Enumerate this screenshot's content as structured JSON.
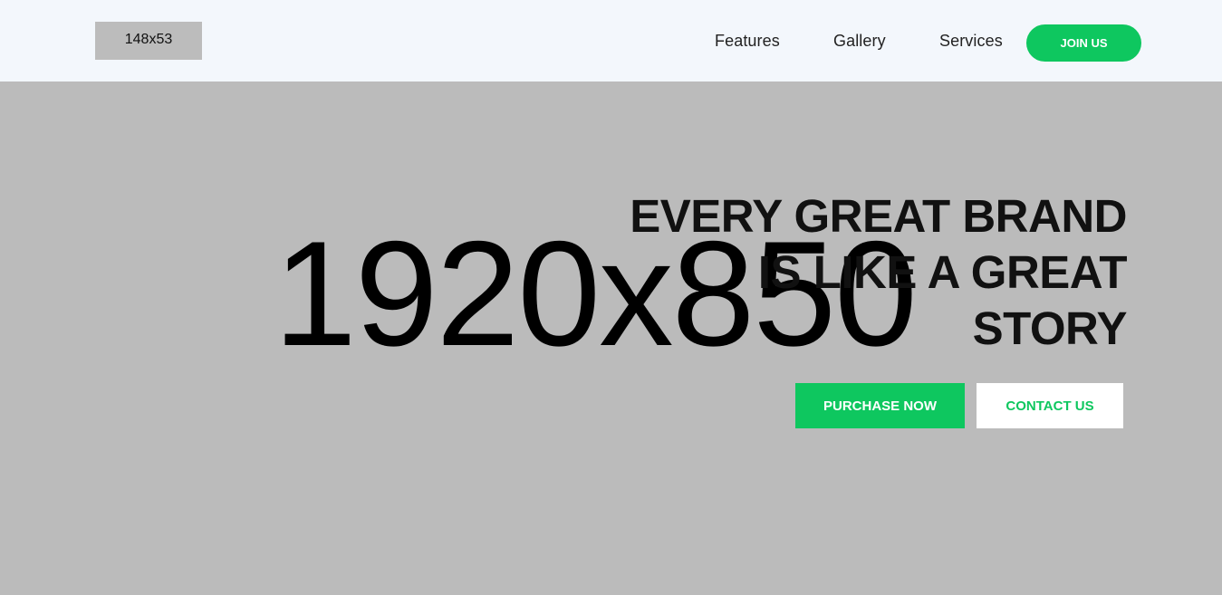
{
  "header": {
    "logo_text": "148x53",
    "nav": {
      "features": "Features",
      "gallery": "Gallery",
      "services": "Services"
    },
    "join_label": "JOIN US"
  },
  "hero": {
    "placeholder_text": "1920x850",
    "headline": {
      "line1": "EVERY GREAT BRAND",
      "line2": "IS LIKE A GREAT",
      "line3": "STORY"
    },
    "purchase_label": "PURCHASE NOW",
    "contact_label": "CONTACT US"
  },
  "colors": {
    "accent": "#0ec75f",
    "header_bg": "#f3f7fc",
    "hero_bg": "#bbbbbb"
  }
}
